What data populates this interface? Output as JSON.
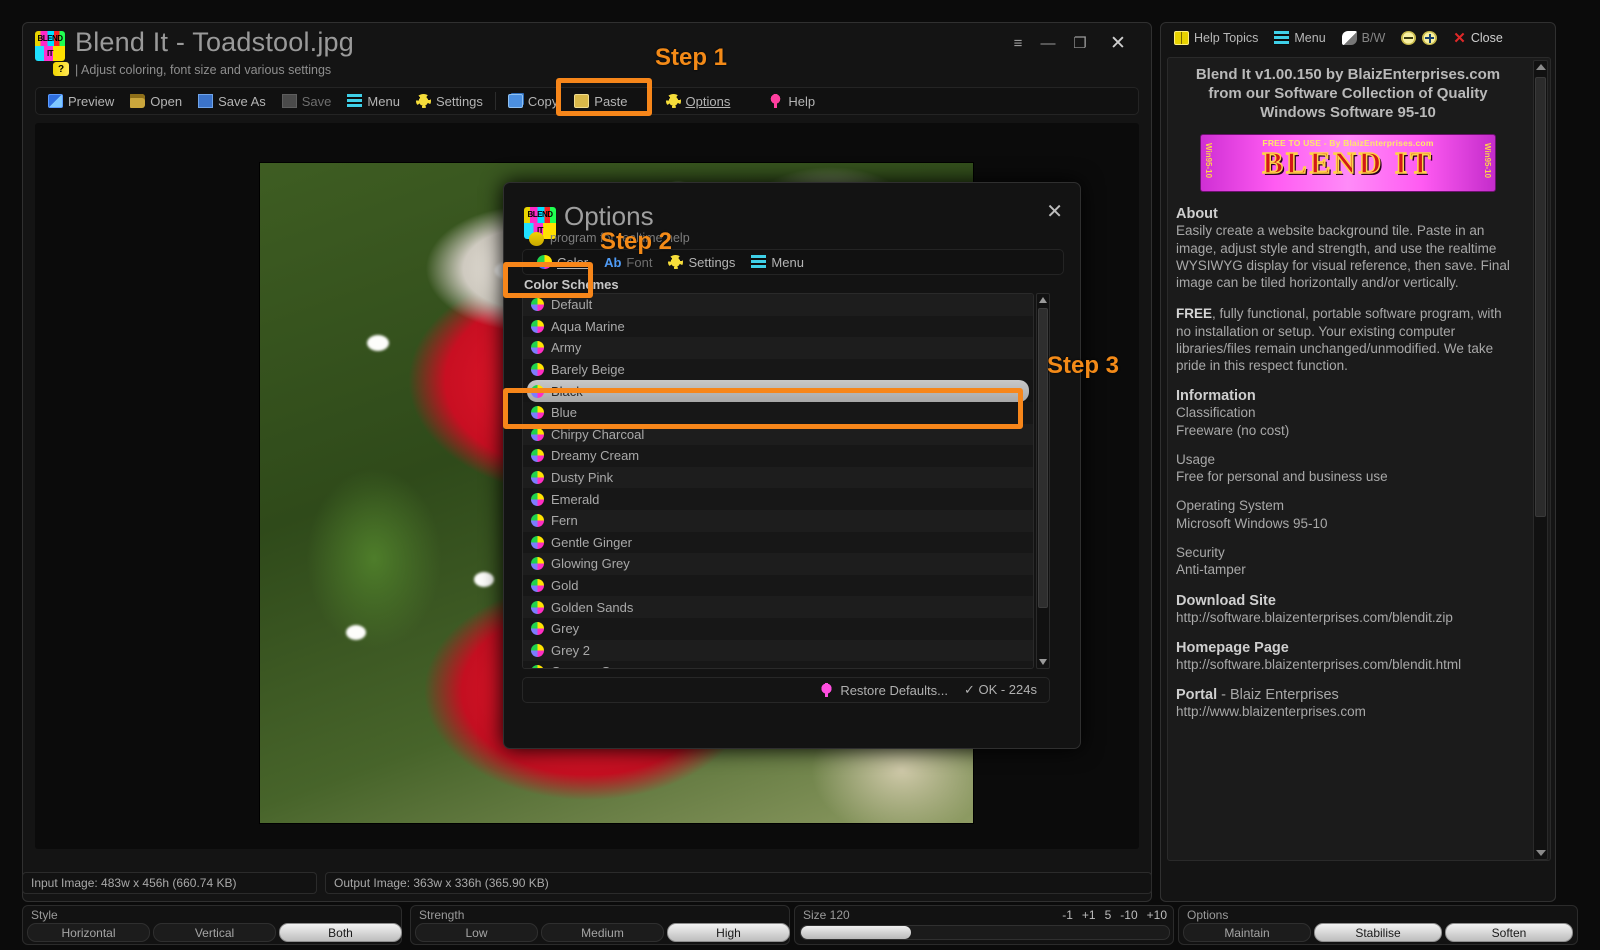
{
  "window": {
    "title": "Blend It - Toadstool.jpg",
    "subtitle": "| Adjust coloring, font size and various settings",
    "logo_top": "BLEND",
    "logo_bottom": "IT",
    "controls": {
      "list": "≡",
      "minimize": "—",
      "maximize": "❐",
      "close": "✕"
    }
  },
  "toolbar": {
    "preview": "Preview",
    "open": "Open",
    "save_as": "Save As",
    "save": "Save",
    "menu": "Menu",
    "settings": "Settings",
    "copy": "Copy",
    "paste": "Paste",
    "options": "Options",
    "help": "Help"
  },
  "annotations": {
    "step1": "Step 1",
    "step2": "Step 2",
    "step3": "Step 3",
    "highlight_color": "#f7861a"
  },
  "modal": {
    "title": "Options",
    "subtitle": "program for realtime help",
    "close": "✕",
    "logo_top": "BLEND",
    "logo_bottom": "IT",
    "tabs": [
      {
        "label": "Color",
        "active": true
      },
      {
        "label": "Font",
        "active": false
      },
      {
        "label": "Settings",
        "active": false
      },
      {
        "label": "Menu",
        "active": false
      }
    ],
    "section_label": "Color Schemes",
    "schemes": [
      {
        "name": "Default",
        "selected": false
      },
      {
        "name": "Aqua Marine",
        "selected": false
      },
      {
        "name": "Army",
        "selected": false
      },
      {
        "name": "Barely Beige",
        "selected": false
      },
      {
        "name": "Black",
        "selected": true
      },
      {
        "name": "Blue",
        "selected": false
      },
      {
        "name": "Chirpy Charcoal",
        "selected": false
      },
      {
        "name": "Dreamy Cream",
        "selected": false
      },
      {
        "name": "Dusty Pink",
        "selected": false
      },
      {
        "name": "Emerald",
        "selected": false
      },
      {
        "name": "Fern",
        "selected": false
      },
      {
        "name": "Gentle Ginger",
        "selected": false
      },
      {
        "name": "Glowing Grey",
        "selected": false
      },
      {
        "name": "Gold",
        "selected": false
      },
      {
        "name": "Golden Sands",
        "selected": false
      },
      {
        "name": "Grey",
        "selected": false
      },
      {
        "name": "Grey 2",
        "selected": false
      },
      {
        "name": "Grumpy Green",
        "selected": false
      }
    ],
    "restore_defaults": "Restore Defaults...",
    "ok": "✓ OK - 224s"
  },
  "help_panel": {
    "toolbar": {
      "help_topics": "Help Topics",
      "menu": "Menu",
      "bw": "B/W",
      "zoom_out": "zoom-out",
      "zoom_in": "zoom-in",
      "close": "Close"
    },
    "heading_line1": "Blend It v1.00.150 by BlaizEnterprises.com",
    "heading_line2": "from our Software Collection of Quality",
    "heading_line3": "Windows Software 95-10",
    "banner": {
      "tagline": "FREE TO USE - By BlaizEnterprises.com",
      "title": "BLEND IT",
      "left_label": "Win95-10",
      "right_label": "Win95-10"
    },
    "about_heading": "About",
    "about_text": "Easily create a website background tile.  Paste in an image, adjust style and strength, and use the realtime WYSIWYG display for visual reference, then save.  Final image can be tiled horizontally and/or vertically.",
    "free_bold": "FREE",
    "free_text": ", fully functional, portable software program, with no installation or setup. Your existing computer libraries/files remain unchanged/unmodified.  We take pride in this respect function.",
    "information_heading": "Information",
    "classification_label": "Classification",
    "classification_value": "Freeware (no cost)",
    "usage_label": "Usage",
    "usage_value": "Free for personal and business use",
    "os_label": "Operating System",
    "os_value": "Microsoft Windows 95-10",
    "security_label": "Security",
    "security_value": "Anti-tamper",
    "download_heading": "Download Site",
    "download_url": "http://software.blaizenterprises.com/blendit.zip",
    "homepage_heading": "Homepage Page",
    "homepage_url": "http://software.blaizenterprises.com/blendit.html",
    "portal_heading": "Portal",
    "portal_sub": " - Blaiz Enterprises",
    "portal_url": "http://www.blaizenterprises.com"
  },
  "bottom": {
    "style": {
      "label": "Style",
      "options": [
        {
          "label": "Horizontal",
          "active": false
        },
        {
          "label": "Vertical",
          "active": false
        },
        {
          "label": "Both",
          "active": true
        }
      ]
    },
    "strength": {
      "label": "Strength",
      "options": [
        {
          "label": "Low",
          "active": false
        },
        {
          "label": "Medium",
          "active": false
        },
        {
          "label": "High",
          "active": true
        }
      ]
    },
    "size": {
      "label": "Size 120",
      "value": 120,
      "steppers": [
        "-1",
        "+1",
        "5",
        "-10",
        "+10"
      ],
      "fill_percent": 30
    },
    "options": {
      "label": "Options",
      "options": [
        {
          "label": "Maintain",
          "active": false
        },
        {
          "label": "Stabilise",
          "active": true
        },
        {
          "label": "Soften",
          "active": true
        }
      ]
    },
    "url_bar": "http://www.blaizenterprises.com"
  },
  "status": {
    "input": "Input Image: 483w x 456h (660.74 KB)",
    "output": "Output Image: 363w x 336h (365.90 KB)"
  }
}
